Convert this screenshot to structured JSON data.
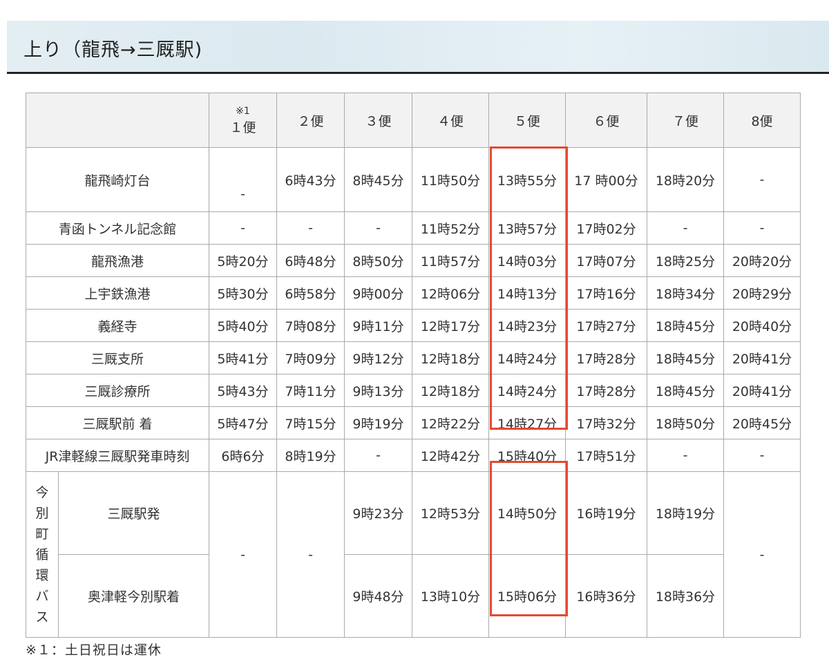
{
  "section": {
    "title": "上り（龍飛→三厩駅)"
  },
  "timetable": {
    "header": {
      "note_mark": "※1",
      "flights": [
        "１便",
        "２便",
        "３便",
        "４便",
        "５便",
        "６便",
        "７便",
        "8便"
      ]
    },
    "stops": [
      {
        "name": "龍飛崎灯台",
        "times": [
          "-",
          "6時43分",
          "8時45分",
          "11時50分",
          "13時55分",
          "17 時00分",
          "18時20分",
          "-"
        ]
      },
      {
        "name": "青函トンネル記念館",
        "times": [
          "-",
          "-",
          "-",
          "11時52分",
          "13時57分",
          "17時02分",
          "-",
          "-"
        ]
      },
      {
        "name": "龍飛漁港",
        "times": [
          "5時20分",
          "6時48分",
          "8時50分",
          "11時57分",
          "14時03分",
          "17時07分",
          "18時25分",
          "20時20分"
        ]
      },
      {
        "name": "上宇鉄漁港",
        "times": [
          "5時30分",
          "6時58分",
          "9時00分",
          "12時06分",
          "14時13分",
          "17時16分",
          "18時34分",
          "20時29分"
        ]
      },
      {
        "name": "義経寺",
        "times": [
          "5時40分",
          "7時08分",
          "9時11分",
          "12時17分",
          "14時23分",
          "17時27分",
          "18時45分",
          "20時40分"
        ]
      },
      {
        "name": "三厩支所",
        "times": [
          "5時41分",
          "7時09分",
          "9時12分",
          "12時18分",
          "14時24分",
          "17時28分",
          "18時45分",
          "20時41分"
        ]
      },
      {
        "name": "三厩診療所",
        "times": [
          "5時43分",
          "7時11分",
          "9時13分",
          "12時18分",
          "14時24分",
          "17時28分",
          "18時45分",
          "20時41分"
        ]
      },
      {
        "name": "三厩駅前 着",
        "times": [
          "5時47分",
          "7時15分",
          "9時19分",
          "12時22分",
          "14時27分",
          "17時32分",
          "18時50分",
          "20時45分"
        ]
      },
      {
        "name": "JR津軽線三厩駅発車時刻",
        "times": [
          "6時6分",
          "8時19分",
          "-",
          "12時42分",
          "15時40分",
          "17時51分",
          "-",
          "-"
        ]
      }
    ],
    "circular_bus": {
      "label": "今別町循環バス",
      "merged": {
        "flight1": "-",
        "flight2": "-",
        "flight8": "-"
      },
      "rows": [
        {
          "name": "三厩駅発",
          "times": [
            "9時23分",
            "12時53分",
            "14時50分",
            "16時19分",
            "18時19分"
          ]
        },
        {
          "name": "奥津軽今別駅着",
          "times": [
            "9時48分",
            "13時10分",
            "15時06分",
            "16時36分",
            "18時36分"
          ]
        }
      ]
    }
  },
  "footnote": "※１：土日祝日は運休",
  "colors": {
    "highlight": "#e4492f",
    "header_background": "#e3eef3",
    "border": "#aaaaaa"
  }
}
